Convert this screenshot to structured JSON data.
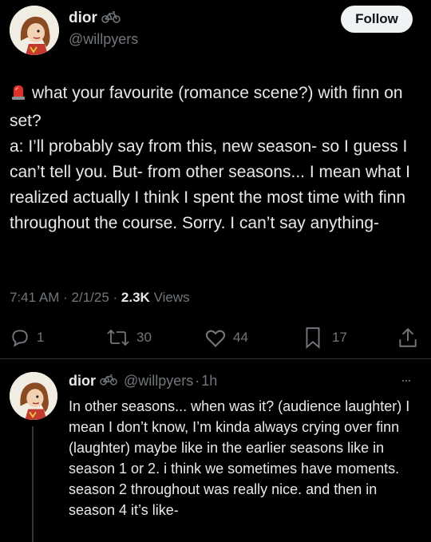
{
  "post": {
    "author": {
      "display_name": "dior",
      "handle": "@willpyers",
      "name_icon": "bicycle-icon"
    },
    "follow_label": "Follow",
    "emoji": "police-light-icon",
    "lines": [
      "what your favourite (romance scene?) with finn on set?",
      "a: I’ll probably say from this, new season- so I guess I can’t tell you. But- from other seasons... I mean what I realized actually I think I spent the most time with finn throughout the course. Sorry. I can’t say anything-"
    ],
    "time": "7:41 AM",
    "date": "2/1/25",
    "views_count": "2.3K",
    "views_label": "Views",
    "separator": "·"
  },
  "actions": {
    "replies": "1",
    "reposts": "30",
    "likes": "44",
    "bookmarks": "17"
  },
  "reply": {
    "display_name": "dior",
    "handle": "@willpyers",
    "time": "1h",
    "separator": "·",
    "more": "···",
    "text": "In other seasons... when was it? (audience laughter) I mean I don’t know, I’m kinda always crying over finn (laughter) maybe like in the earlier seasons like in season 1 or 2. i think we sometimes have moments. season 2 throughout was really nice. and then in season 4 it’s like-"
  },
  "colors": {
    "background": "#000000",
    "text": "#e7e9ea",
    "muted": "#71767b",
    "follow_bg": "#eff3f4"
  }
}
